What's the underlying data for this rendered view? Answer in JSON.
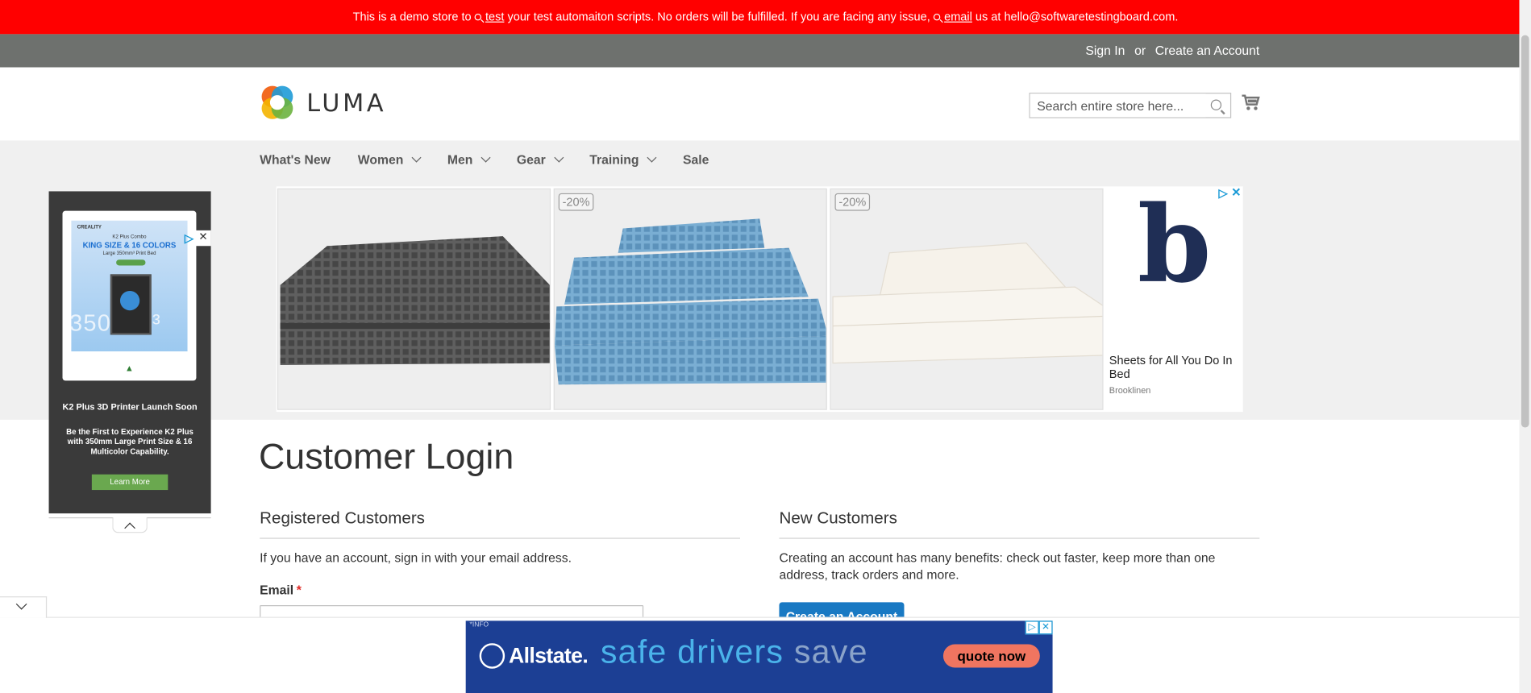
{
  "demo_notice": {
    "prefix": "This is a demo store to",
    "link1": "test",
    "middle": "your test automaiton scripts. No orders will be fulfilled. If you are facing any issue,",
    "link2": "email",
    "suffix": "us at hello@softwaretestingboard.com."
  },
  "header_links": {
    "sign_in": "Sign In",
    "or": "or",
    "create_account": "Create an Account"
  },
  "logo": {
    "text": "LUMA"
  },
  "search": {
    "placeholder": "Search entire store here..."
  },
  "nav": {
    "items": [
      {
        "label": "What's New",
        "dropdown": false
      },
      {
        "label": "Women",
        "dropdown": true
      },
      {
        "label": "Men",
        "dropdown": true
      },
      {
        "label": "Gear",
        "dropdown": true
      },
      {
        "label": "Training",
        "dropdown": true
      },
      {
        "label": "Sale",
        "dropdown": false
      }
    ]
  },
  "ad_main": {
    "badges": [
      "-20%",
      "-20%"
    ],
    "side_logo": "b",
    "headline": "Sheets for All You Do In Bed",
    "brand": "Brooklinen"
  },
  "ad_left": {
    "brand": "CREALITY",
    "combo": "K2 Plus Combo",
    "headline": "KING SIZE & 16 COLORS",
    "sub": "Large 350mm³ Print Bed",
    "big": "350mm³",
    "title": "K2 Plus 3D Printer Launch Soon",
    "description": "Be the First to Experience K2 Plus with 350mm Large Print Size & 16 Multicolor Capability.",
    "button": "Learn More"
  },
  "page": {
    "title": "Customer Login"
  },
  "registered": {
    "title": "Registered Customers",
    "intro": "If you have an account, sign in with your email address.",
    "email_label": "Email",
    "required_mark": "*"
  },
  "new_customers": {
    "title": "New Customers",
    "text": "Creating an account has many benefits: check out faster, keep more than one address, track orders and more.",
    "button": "Create an Account"
  },
  "ad_bottom": {
    "info": "*INFO",
    "brand": "Allstate.",
    "tag1": "safe drivers",
    "tag2": "save",
    "cta": "quote now"
  },
  "colors": {
    "demo_bar": "#ff0000",
    "top_bar": "#6e716e",
    "primary_button": "#1979c3",
    "required": "#e02b27"
  }
}
